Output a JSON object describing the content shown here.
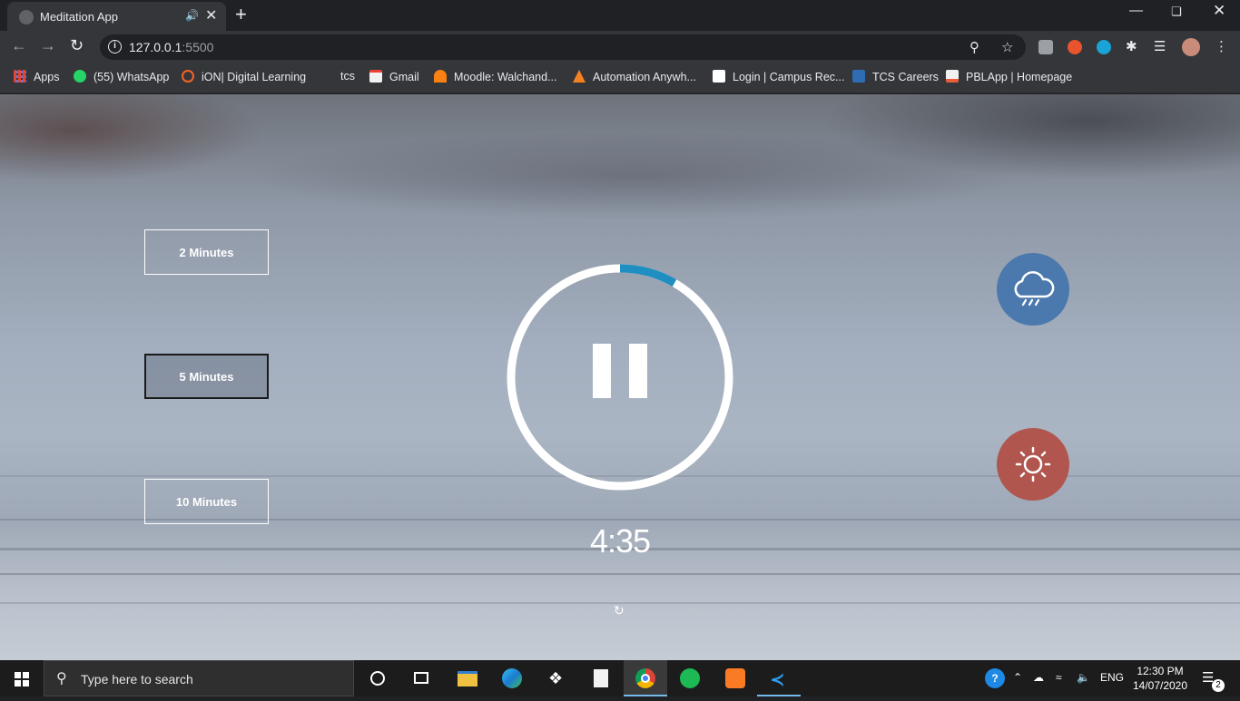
{
  "browser": {
    "tab_title": "Meditation App",
    "url_host": "127.0.0.1",
    "url_port": ":5500",
    "new_tab": "+"
  },
  "bookmarks": [
    {
      "label": "Apps",
      "color": "#ea4335"
    },
    {
      "label": "(55) WhatsApp",
      "color": "#25d366"
    },
    {
      "label": "iON| Digital Learning",
      "color": "#f26522"
    },
    {
      "label": "tcs",
      "color": ""
    },
    {
      "label": "Gmail",
      "color": "#ea4335"
    },
    {
      "label": "Moodle: Walchand...",
      "color": "#f98012"
    },
    {
      "label": "Automation Anywh...",
      "color": "#f58220"
    },
    {
      "label": "Login | Campus Rec...",
      "color": "#ffffff"
    },
    {
      "label": "TCS Careers",
      "color": "#2e6db4"
    },
    {
      "label": "PBLApp | Homepage",
      "color": "#f1f1f1"
    }
  ],
  "app": {
    "durations": [
      "2 Minutes",
      "5 Minutes",
      "10 Minutes"
    ],
    "active_duration": "5 Minutes",
    "time_display": "4:35",
    "progress_fraction": 0.0833,
    "play_state": "paused",
    "progress_color": "#1e8fc0",
    "sounds": [
      {
        "name": "rain",
        "icon": "cloud-rain-icon",
        "color": "#4b79ad"
      },
      {
        "name": "sun",
        "icon": "sun-icon",
        "color": "#b0564e"
      }
    ]
  },
  "taskbar": {
    "search_placeholder": "Type here to search",
    "lang": "ENG",
    "time": "12:30 PM",
    "date": "14/07/2020",
    "notifications": "2"
  }
}
